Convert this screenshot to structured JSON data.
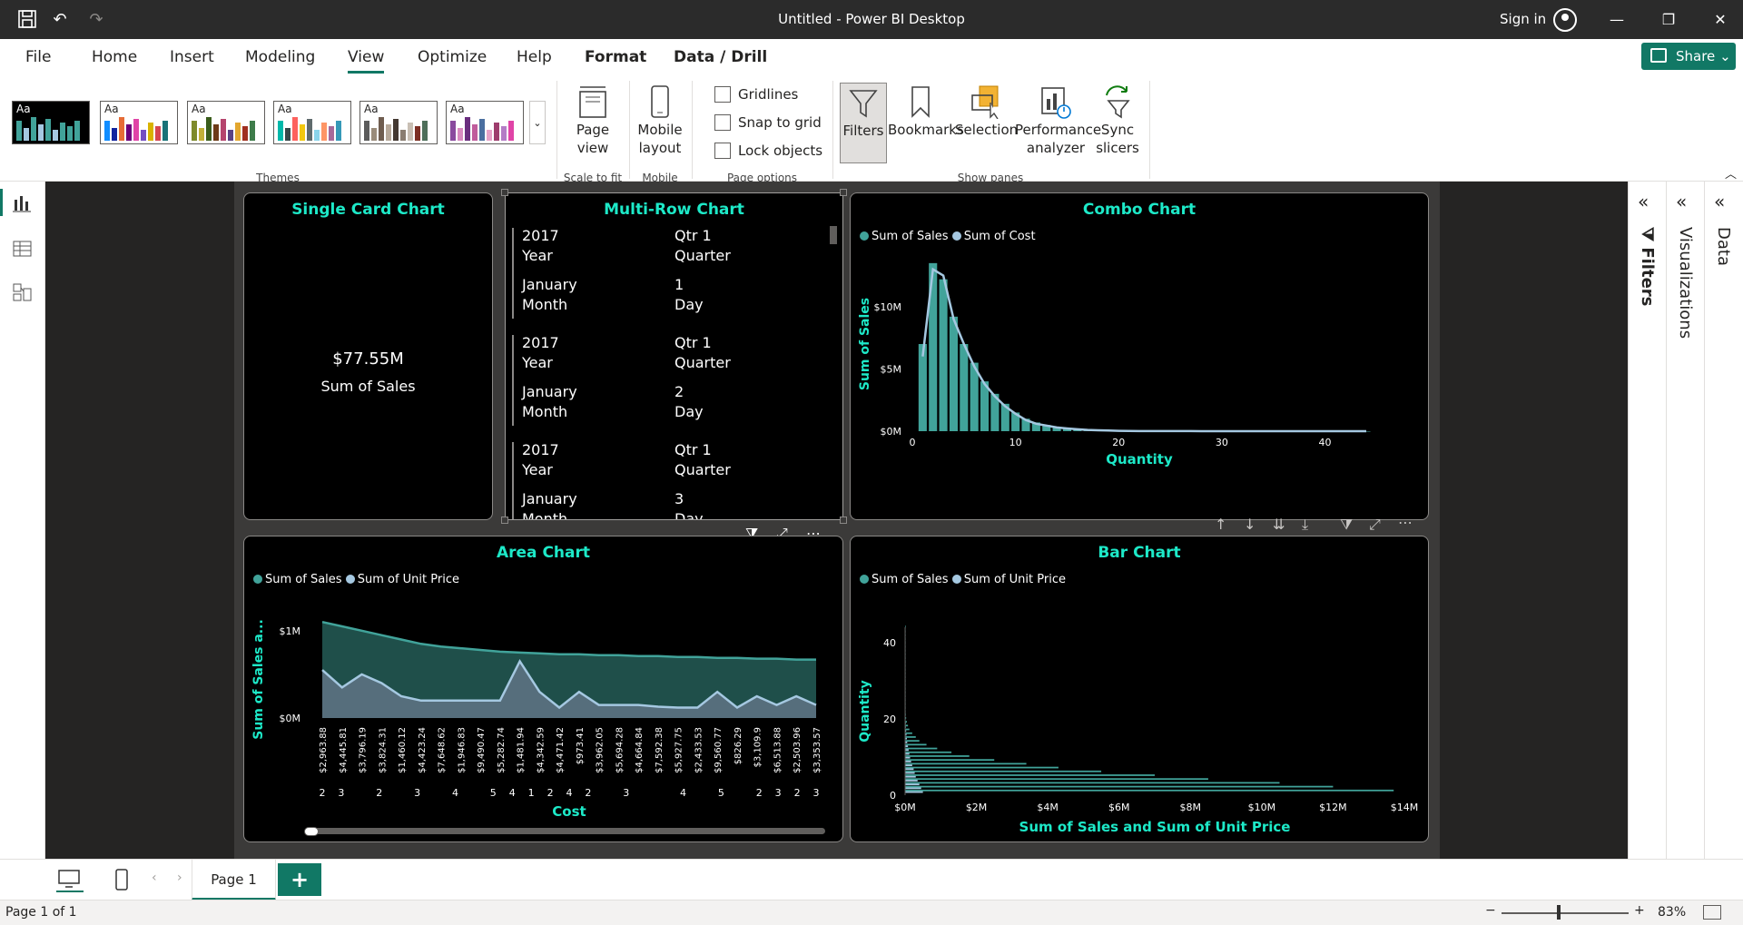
{
  "titlebar": {
    "title": "Untitled - Power BI Desktop",
    "signin": "Sign in"
  },
  "menu": {
    "items": [
      "File",
      "Home",
      "Insert",
      "Modeling",
      "View",
      "Optimize",
      "Help",
      "Format",
      "Data / Drill"
    ],
    "active": "View"
  },
  "share": {
    "label": "Share"
  },
  "ribbon": {
    "themes_label": "Themes",
    "theme_sample": "Aa",
    "page_view": {
      "label": "Page view",
      "group": "Scale to fit"
    },
    "mobile_layout": {
      "label": "Mobile layout",
      "group": "Mobile"
    },
    "page_options": {
      "group": "Page options",
      "gridlines": "Gridlines",
      "snap": "Snap to grid",
      "lock": "Lock objects"
    },
    "show_panes": {
      "group": "Show panes",
      "filters": "Filters",
      "bookmarks": "Bookmarks",
      "selection": "Selection",
      "performance": "Performance analyzer",
      "sync": "Sync slicers"
    }
  },
  "single_card": {
    "title": "Single Card Chart",
    "value": "$77.55M",
    "label": "Sum of Sales"
  },
  "multi_row": {
    "title": "Multi-Row Chart",
    "records": [
      {
        "year": "2017",
        "year_label": "Year",
        "qtr": "Qtr 1",
        "qtr_label": "Quarter",
        "month": "January",
        "month_label": "Month",
        "day": "1",
        "day_label": "Day"
      },
      {
        "year": "2017",
        "year_label": "Year",
        "qtr": "Qtr 1",
        "qtr_label": "Quarter",
        "month": "January",
        "month_label": "Month",
        "day": "2",
        "day_label": "Day"
      },
      {
        "year": "2017",
        "year_label": "Year",
        "qtr": "Qtr 1",
        "qtr_label": "Quarter",
        "month": "January",
        "month_label": "Month",
        "day": "3",
        "day_label": "Day"
      }
    ]
  },
  "combo": {
    "title": "Combo Chart"
  },
  "area": {
    "title": "Area Chart"
  },
  "bar": {
    "title": "Bar Chart"
  },
  "colors": {
    "series1": "#41a39a",
    "series2": "#a5c8e1",
    "accent": "#1de9c8",
    "brand": "#117865"
  },
  "chart_data": [
    {
      "type": "bar",
      "title": "Combo Chart",
      "xlabel": "Quantity",
      "ylabel": "Sum of Sales",
      "series": [
        {
          "name": "Sum of Sales",
          "values": [
            7.0,
            13.5,
            12.2,
            9.2,
            7.0,
            5.5,
            4.0,
            3.0,
            2.2,
            1.5,
            1.0,
            0.7,
            0.5,
            0.35,
            0.25,
            0.18,
            0.12,
            0.08,
            0.05,
            0.03,
            0.02,
            0.01,
            0.01,
            0.01,
            0.005,
            0.005,
            0.004,
            0.003,
            0.003,
            0.002,
            0.002,
            0.002,
            0.001,
            0.001,
            0.001,
            0.001,
            0.001,
            0.001,
            0.001,
            0.001,
            0.001,
            0.001,
            0.001,
            0.001
          ]
        },
        {
          "name": "Sum of Cost",
          "values": [
            6.0,
            13.0,
            12.5,
            9.0,
            7.0,
            5.2,
            3.8,
            2.8,
            2.0,
            1.4,
            0.9,
            0.6,
            0.45,
            0.3,
            0.22,
            0.15,
            0.1,
            0.07,
            0.05,
            0.03,
            0.02,
            0.01,
            0.01,
            0.01,
            0.005,
            0.005,
            0.004,
            0.003,
            0.003,
            0.002,
            0.002,
            0.002,
            0.001,
            0.001,
            0.001,
            0.001,
            0.001,
            0.001,
            0.001,
            0.001,
            0.001,
            0.001,
            0.001,
            0.001
          ]
        }
      ],
      "x_start": 1,
      "xticks": [
        "0",
        "10",
        "20",
        "30",
        "40"
      ],
      "xlim": [
        0,
        44
      ],
      "yticks": [
        "$0M",
        "$5M",
        "$10M"
      ],
      "ylim": [
        0,
        14
      ]
    },
    {
      "type": "area",
      "title": "Area Chart",
      "xlabel": "Cost",
      "ylabel": "Sum of Sales a...",
      "categories": [
        "$2,963.88",
        "$4,445.81",
        "$3,796.19",
        "$3,824.31",
        "$1,460.12",
        "$4,423.24",
        "$7,648.62",
        "$1,946.83",
        "$9,490.47",
        "$5,282.74",
        "$1,481.94",
        "$4,342.59",
        "$4,471.42",
        "$973.41",
        "$3,962.05",
        "$5,694.28",
        "$4,664.84",
        "$7,592.38",
        "$5,927.75",
        "$2,433.53",
        "$9,560.77",
        "$826.29",
        "$3,109.9",
        "$6,513.88",
        "$2,503.96",
        "$3,353.57"
      ],
      "quantity_labels": [
        "2",
        "3",
        "",
        "2",
        "",
        "3",
        "",
        "4",
        "",
        "5",
        "4",
        "1",
        "2",
        "4",
        "2",
        "",
        "3",
        "",
        "",
        "4",
        "",
        "5",
        "",
        "2",
        "3",
        "2",
        "3"
      ],
      "series": [
        {
          "name": "Sum of Sales",
          "values": [
            1.1,
            1.05,
            1.0,
            0.95,
            0.9,
            0.85,
            0.82,
            0.8,
            0.78,
            0.76,
            0.75,
            0.74,
            0.73,
            0.73,
            0.72,
            0.72,
            0.71,
            0.71,
            0.7,
            0.7,
            0.69,
            0.69,
            0.68,
            0.68,
            0.67,
            0.67
          ]
        },
        {
          "name": "Sum of Unit Price",
          "values": [
            0.55,
            0.35,
            0.5,
            0.4,
            0.25,
            0.2,
            0.2,
            0.2,
            0.2,
            0.2,
            0.65,
            0.3,
            0.12,
            0.3,
            0.15,
            0.15,
            0.15,
            0.13,
            0.12,
            0.12,
            0.3,
            0.12,
            0.25,
            0.15,
            0.25,
            0.15
          ]
        }
      ],
      "yticks": [
        "$0M",
        "$1M"
      ],
      "ylim": [
        0,
        1.3
      ]
    },
    {
      "type": "bar",
      "orientation": "horizontal",
      "title": "Bar Chart",
      "xlabel": "Sum of Sales and Sum of Unit Price",
      "ylabel": "Quantity",
      "series": [
        {
          "name": "Sum of Sales",
          "values": [
            13.7,
            12.0,
            10.5,
            8.5,
            7.0,
            5.5,
            4.3,
            3.4,
            2.5,
            1.8,
            1.3,
            0.9,
            0.6,
            0.4,
            0.3,
            0.2,
            0.12,
            0.08,
            0.05,
            0.03,
            0.02,
            0.01,
            0.01,
            0.01,
            0.005,
            0.005,
            0.005,
            0.004,
            0.004,
            0.003,
            0.003,
            0.003,
            0.002,
            0.002,
            0.002,
            0.002,
            0.001,
            0.001,
            0.001,
            0.001,
            0.001,
            0.001,
            0.001,
            0.001
          ]
        },
        {
          "name": "Sum of Unit Price",
          "values": [
            0.5,
            0.45,
            0.4,
            0.35,
            0.3,
            0.27,
            0.24,
            0.2,
            0.17,
            0.14,
            0.12,
            0.1,
            0.08,
            0.06,
            0.05,
            0.04,
            0.03,
            0.02,
            0.02,
            0.01,
            0.01,
            0.01,
            0.01,
            0.01,
            0.005,
            0.005,
            0.005,
            0.004,
            0.004,
            0.003,
            0.003,
            0.003,
            0.002,
            0.002,
            0.002,
            0.002,
            0.001,
            0.001,
            0.001,
            0.001,
            0.001,
            0.001,
            0.001,
            0.001
          ]
        }
      ],
      "xticks": [
        "$0M",
        "$2M",
        "$4M",
        "$6M",
        "$8M",
        "$10M",
        "$12M",
        "$14M"
      ],
      "xlim": [
        0,
        14
      ],
      "yticks": [
        "0",
        "20",
        "40"
      ],
      "ylim": [
        0,
        44
      ]
    }
  ],
  "bottombar": {
    "page_tab": "Page 1",
    "add": "+"
  },
  "status": {
    "page": "Page 1 of 1",
    "zoom": "83%"
  },
  "panes": {
    "filters": "Filters",
    "visualizations": "Visualizations",
    "data": "Data"
  }
}
